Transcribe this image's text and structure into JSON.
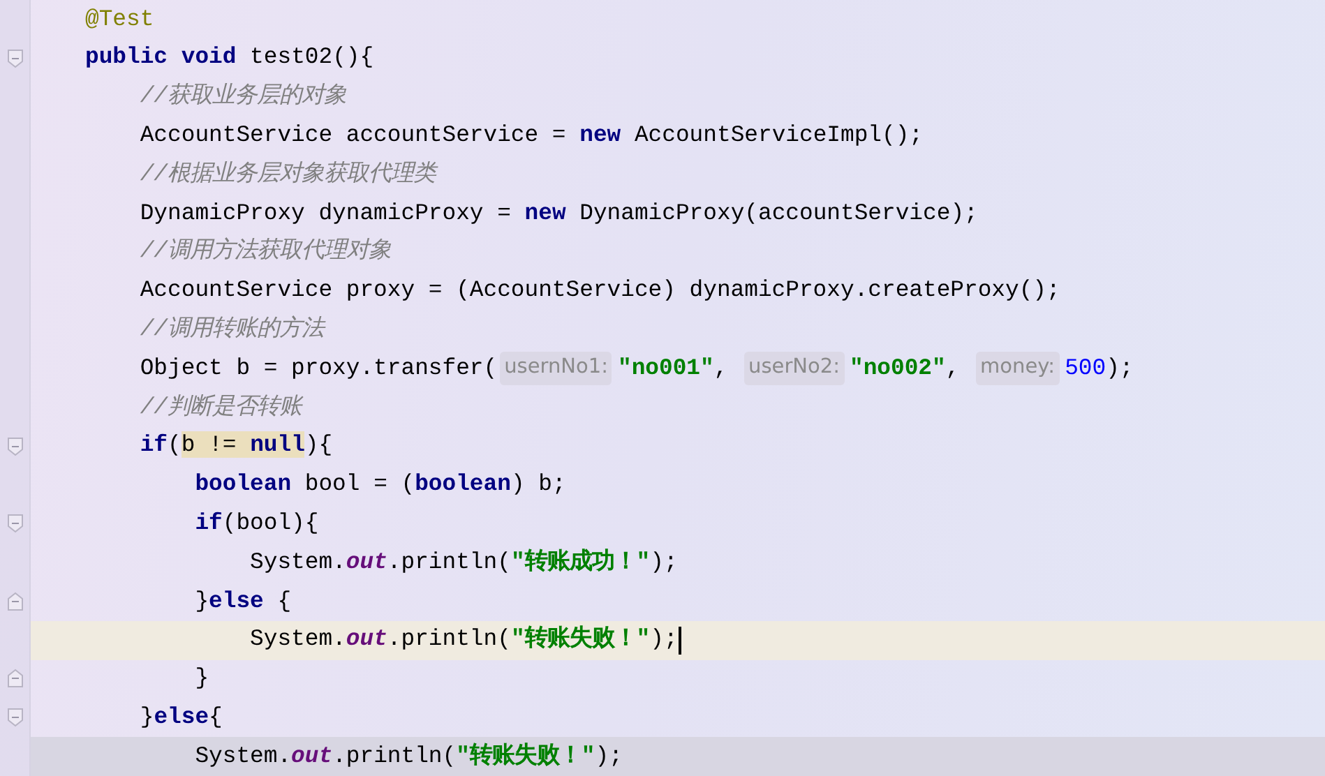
{
  "editor": {
    "lines": [
      {
        "kind": "code",
        "tokens": [
          {
            "kind": "annotation",
            "text": "@Test"
          }
        ]
      },
      {
        "kind": "opener",
        "tokens": [
          {
            "kind": "keyword",
            "text": "public "
          },
          {
            "kind": "keyword",
            "text": "void"
          },
          {
            "kind": "plain",
            "text": " test02(){"
          }
        ]
      },
      {
        "kind": "code",
        "tokens": [
          {
            "kind": "comment",
            "text": "    //获取业务层的对象"
          }
        ]
      },
      {
        "kind": "code",
        "tokens": [
          {
            "kind": "plain",
            "text": "    AccountService accountService = "
          },
          {
            "kind": "keyword",
            "text": "new"
          },
          {
            "kind": "plain",
            "text": " AccountServiceImpl();"
          }
        ]
      },
      {
        "kind": "code",
        "tokens": [
          {
            "kind": "comment",
            "text": "    //根据业务层对象获取代理类"
          }
        ]
      },
      {
        "kind": "code",
        "tokens": [
          {
            "kind": "plain",
            "text": "    DynamicProxy dynamicProxy = "
          },
          {
            "kind": "keyword",
            "text": "new"
          },
          {
            "kind": "plain",
            "text": " DynamicProxy(accountService);"
          }
        ]
      },
      {
        "kind": "code",
        "tokens": [
          {
            "kind": "comment",
            "text": "    //调用方法获取代理对象"
          }
        ]
      },
      {
        "kind": "code",
        "tokens": [
          {
            "kind": "plain",
            "text": "    AccountService proxy = (AccountService) dynamicProxy.createProxy();"
          }
        ]
      },
      {
        "kind": "code",
        "tokens": [
          {
            "kind": "comment",
            "text": "    //调用转账的方法"
          }
        ]
      },
      {
        "kind": "code",
        "tokens": [
          {
            "kind": "plain",
            "text": "    Object b = proxy.transfer("
          },
          {
            "kind": "hint",
            "text": "usernNo1:"
          },
          {
            "kind": "string",
            "text": "\"no001\""
          },
          {
            "kind": "plain",
            "text": ", "
          },
          {
            "kind": "hint",
            "text": "userNo2:"
          },
          {
            "kind": "string",
            "text": "\"no002\""
          },
          {
            "kind": "plain",
            "text": ", "
          },
          {
            "kind": "hint",
            "text": "money:"
          },
          {
            "kind": "number",
            "text": "500"
          },
          {
            "kind": "plain",
            "text": ");"
          }
        ]
      },
      {
        "kind": "code",
        "tokens": [
          {
            "kind": "comment",
            "text": "    //判断是否转账"
          }
        ]
      },
      {
        "kind": "opener",
        "tokens": [
          {
            "kind": "keyword",
            "text": "    if"
          },
          {
            "kind": "plain",
            "text": "("
          },
          {
            "kind": "match",
            "children": [
              {
                "kind": "plain",
                "text": "b != "
              },
              {
                "kind": "keyword",
                "text": "null"
              }
            ]
          },
          {
            "kind": "plain",
            "text": "){"
          }
        ]
      },
      {
        "kind": "code",
        "tokens": [
          {
            "kind": "keyword",
            "text": "        boolean"
          },
          {
            "kind": "plain",
            "text": " bool = ("
          },
          {
            "kind": "keyword",
            "text": "boolean"
          },
          {
            "kind": "plain",
            "text": ") b;"
          }
        ]
      },
      {
        "kind": "opener",
        "tokens": [
          {
            "kind": "keyword",
            "text": "        if"
          },
          {
            "kind": "plain",
            "text": "(bool){"
          }
        ]
      },
      {
        "kind": "code",
        "tokens": [
          {
            "kind": "plain",
            "text": "            System."
          },
          {
            "kind": "static",
            "text": "out"
          },
          {
            "kind": "plain",
            "text": ".println("
          },
          {
            "kind": "string",
            "text": "\"转账成功！\""
          },
          {
            "kind": "plain",
            "text": ");"
          }
        ]
      },
      {
        "kind": "closer",
        "tokens": [
          {
            "kind": "plain",
            "text": "        }"
          },
          {
            "kind": "keyword",
            "text": "else"
          },
          {
            "kind": "plain",
            "text": " {"
          }
        ]
      },
      {
        "kind": "code",
        "current": true,
        "tokens": [
          {
            "kind": "plain",
            "text": "            System."
          },
          {
            "kind": "static",
            "text": "out"
          },
          {
            "kind": "plain",
            "text": ".println("
          },
          {
            "kind": "string",
            "text": "\"转账失败！\""
          },
          {
            "kind": "plain",
            "text": ");"
          }
        ]
      },
      {
        "kind": "closer",
        "tokens": [
          {
            "kind": "plain",
            "text": "        }"
          }
        ]
      },
      {
        "kind": "opener",
        "tokens": [
          {
            "kind": "plain",
            "text": "    }"
          },
          {
            "kind": "keyword",
            "text": "else"
          },
          {
            "kind": "plain",
            "text": "{"
          }
        ]
      },
      {
        "kind": "code",
        "shaded": true,
        "tokens": [
          {
            "kind": "plain",
            "text": "        System."
          },
          {
            "kind": "static",
            "text": "out"
          },
          {
            "kind": "plain",
            "text": ".println("
          },
          {
            "kind": "string",
            "text": "\"转账失败！\""
          },
          {
            "kind": "plain",
            "text": ");"
          }
        ]
      }
    ]
  }
}
